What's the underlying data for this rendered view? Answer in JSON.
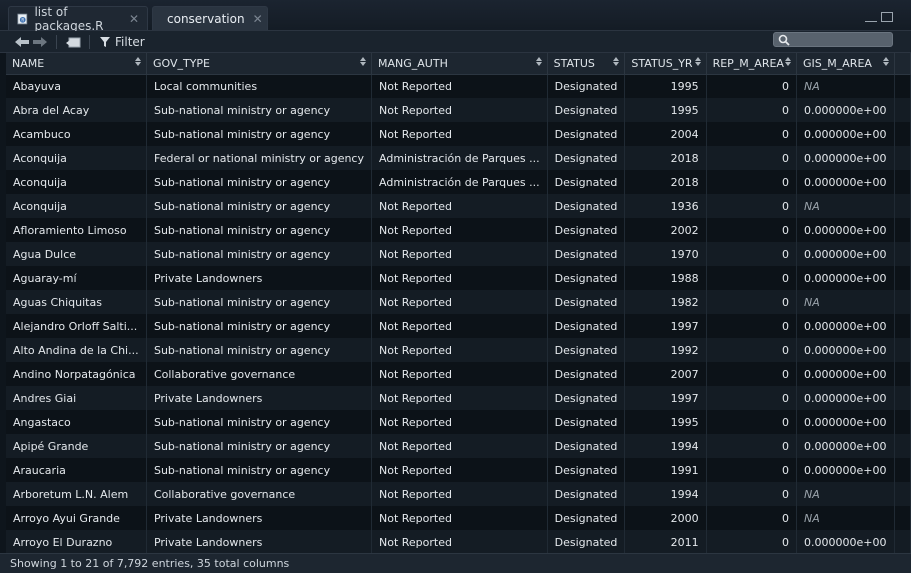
{
  "tabs": [
    {
      "label": "list of packages.R",
      "active": false,
      "icon": "r-script-icon"
    },
    {
      "label": "conservation",
      "active": true,
      "icon": "table-grid-icon"
    }
  ],
  "toolbar": {
    "filter_label": "Filter",
    "search_placeholder": ""
  },
  "columns": [
    "NAME",
    "GOV_TYPE",
    "MANG_AUTH",
    "STATUS",
    "STATUS_YR",
    "REP_M_AREA",
    "GIS_M_AREA"
  ],
  "rows": [
    [
      "Abayuva",
      "Local communities",
      "Not Reported",
      "Designated",
      "1995",
      "0",
      "NA"
    ],
    [
      "Abra del Acay",
      "Sub-national ministry or agency",
      "Not Reported",
      "Designated",
      "1995",
      "0",
      "0.000000e+00"
    ],
    [
      "Acambuco",
      "Sub-national ministry or agency",
      "Not Reported",
      "Designated",
      "2004",
      "0",
      "0.000000e+00"
    ],
    [
      "Aconquija",
      "Federal or national ministry or agency",
      "Administración de Parques ...",
      "Designated",
      "2018",
      "0",
      "0.000000e+00"
    ],
    [
      "Aconquija",
      "Sub-national ministry or agency",
      "Administración de Parques ...",
      "Designated",
      "2018",
      "0",
      "0.000000e+00"
    ],
    [
      "Aconquija",
      "Sub-national ministry or agency",
      "Not Reported",
      "Designated",
      "1936",
      "0",
      "NA"
    ],
    [
      "Afloramiento Limoso",
      "Sub-national ministry or agency",
      "Not Reported",
      "Designated",
      "2002",
      "0",
      "0.000000e+00"
    ],
    [
      "Agua Dulce",
      "Sub-national ministry or agency",
      "Not Reported",
      "Designated",
      "1970",
      "0",
      "0.000000e+00"
    ],
    [
      "Aguaray-mí",
      "Private Landowners",
      "Not Reported",
      "Designated",
      "1988",
      "0",
      "0.000000e+00"
    ],
    [
      "Aguas Chiquitas",
      "Sub-national ministry or agency",
      "Not Reported",
      "Designated",
      "1982",
      "0",
      "NA"
    ],
    [
      "Alejandro Orloff  Salti...",
      "Sub-national ministry or agency",
      "Not Reported",
      "Designated",
      "1997",
      "0",
      "0.000000e+00"
    ],
    [
      "Alto Andina de la Chi...",
      "Sub-national ministry or agency",
      "Not Reported",
      "Designated",
      "1992",
      "0",
      "0.000000e+00"
    ],
    [
      "Andino Norpatagónica",
      "Collaborative governance",
      "Not Reported",
      "Designated",
      "2007",
      "0",
      "0.000000e+00"
    ],
    [
      "Andres Giai",
      "Private Landowners",
      "Not Reported",
      "Designated",
      "1997",
      "0",
      "0.000000e+00"
    ],
    [
      "Angastaco",
      "Sub-national ministry or agency",
      "Not Reported",
      "Designated",
      "1995",
      "0",
      "0.000000e+00"
    ],
    [
      "Apipé Grande",
      "Sub-national ministry or agency",
      "Not Reported",
      "Designated",
      "1994",
      "0",
      "0.000000e+00"
    ],
    [
      "Araucaria",
      "Sub-national ministry or agency",
      "Not Reported",
      "Designated",
      "1991",
      "0",
      "0.000000e+00"
    ],
    [
      "Arboretum L.N. Alem",
      "Collaborative governance",
      "Not Reported",
      "Designated",
      "1994",
      "0",
      "NA"
    ],
    [
      "Arroyo Ayui Grande",
      "Private Landowners",
      "Not Reported",
      "Designated",
      "2000",
      "0",
      "NA"
    ],
    [
      "Arroyo El Durazno",
      "Private Landowners",
      "Not Reported",
      "Designated",
      "2011",
      "0",
      "0.000000e+00"
    ]
  ],
  "status_text": "Showing 1 to 21 of 7,792 entries, 35 total columns"
}
